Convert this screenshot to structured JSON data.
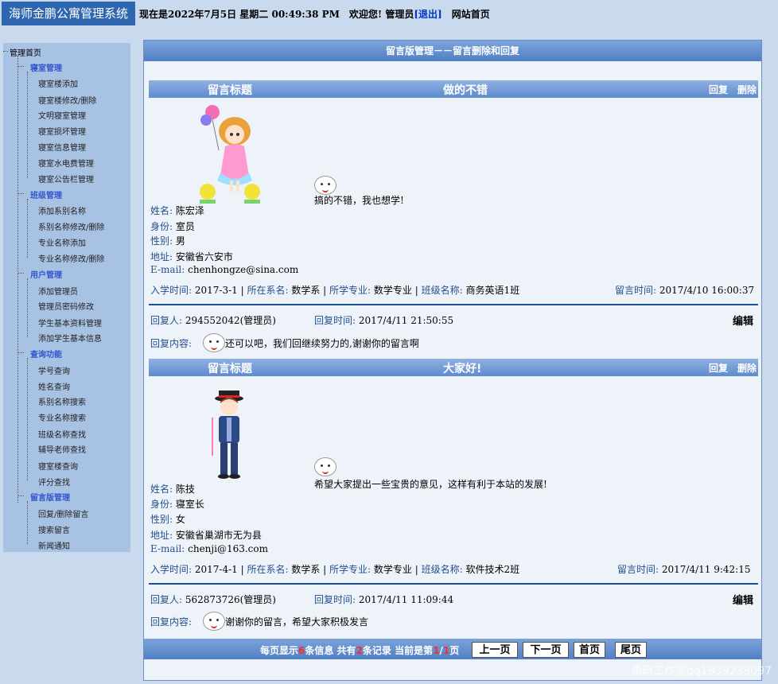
{
  "header": {
    "brand": "海师金鹏公寓管理系统",
    "now_prefix": "现在是",
    "datetime": "2022年7月5日 星期二 00:49:38 PM",
    "welcome": "欢迎您! 管理员",
    "logout": "[退出]",
    "home": "网站首页"
  },
  "sidebar": {
    "root": "管理首页",
    "groups": [
      {
        "label": "寝室管理",
        "items": [
          "寝室楼添加",
          "寝室楼修改/删除",
          "文明寝室管理",
          "寝室损坏管理",
          "寝室信息管理",
          "寝室水电费管理",
          "寝室公告栏管理"
        ]
      },
      {
        "label": "班级管理",
        "items": [
          "添加系别名称",
          "系别名称修改/删除",
          "专业名称添加",
          "专业名称修改/删除"
        ]
      },
      {
        "label": "用户管理",
        "items": [
          "添加管理员",
          "管理员密码修改",
          "学生基本资料管理",
          "添加学生基本信息"
        ]
      },
      {
        "label": "查询功能",
        "items": [
          "学号查询",
          "姓名查询",
          "系别名称搜索",
          "专业名称搜索",
          "班级名称查找",
          "辅导老师查找",
          "寝室楼查询",
          "评分查找"
        ]
      },
      {
        "label": "留言版管理",
        "items": [
          "回复/删除留言",
          "搜索留言",
          "新闻通知"
        ]
      }
    ]
  },
  "main": {
    "title": "留言版管理－－留言删除和回复",
    "labels": {
      "head": "留言标题",
      "reply": "回复",
      "delete": "删除",
      "name": "姓名:",
      "role": "身份:",
      "gender": "性别:",
      "address": "地址:",
      "email": "E-mail:",
      "enroll": "入学时间:",
      "dept": "所在系名:",
      "major": "所学专业:",
      "class": "班级名称:",
      "posted": "留言时间:",
      "replier": "回复人:",
      "reply_time": "回复时间:",
      "reply_content": "回复内容:",
      "edit": "编辑"
    },
    "messages": [
      {
        "title": "做的不错",
        "avatar_icon": "girl-with-balloons-avatar",
        "content": "搞的不错，我也想学!",
        "name": "陈宏泽",
        "role": "室员",
        "gender": "男",
        "address": "安徽省六安市",
        "email": "chenhongze@sina.com",
        "enroll": "2017-3-1",
        "dept": "数学系",
        "major": "数学专业",
        "class": "商务英语1班",
        "posted": "2017/4/10 16:00:37",
        "replier": "294552042(管理员)",
        "reply_time": "2017/4/11 21:50:55",
        "reply_content": "还可以吧，我们回继续努力的,谢谢你的留言啊"
      },
      {
        "title": "大家好!",
        "avatar_icon": "boy-with-hat-avatar",
        "content": "希望大家提出一些宝贵的意见，这样有利于本站的发展!",
        "name": "陈技",
        "role": "寝室长",
        "gender": "女",
        "address": "安徽省巢湖市无为县",
        "email": "chenji@163.com",
        "enroll": "2017-4-1",
        "dept": "数学系",
        "major": "数学专业",
        "class": "软件技术2班",
        "posted": "2017/4/11 9:42:15",
        "replier": "562873726(管理员)",
        "reply_time": "2017/4/11 11:09:44",
        "reply_content": "谢谢你的留言，希望大家积极发言"
      }
    ],
    "pager": {
      "t1": "每页显示",
      "per_page": "6",
      "t2": "条信息 共有",
      "total": "2",
      "t3": "条记录 当前是第",
      "current": "1",
      "slash": "/",
      "pages": "1",
      "t4": "页",
      "prev": "上一页",
      "next": "下一页",
      "first": "首页",
      "last": "尾页"
    }
  },
  "watermark": "源码工作室qq1939239097"
}
